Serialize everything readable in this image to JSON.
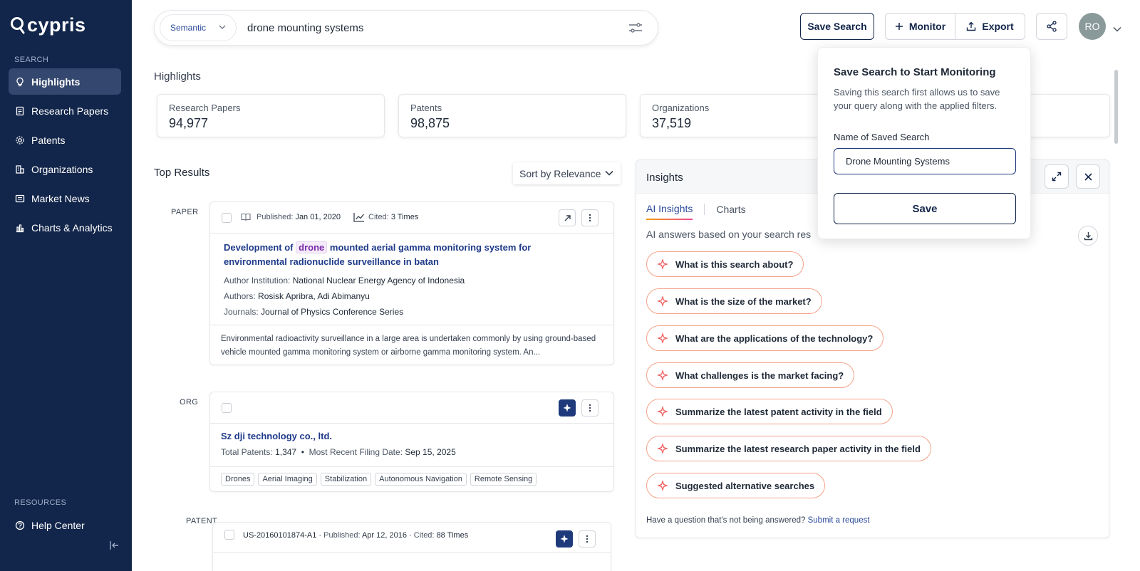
{
  "brand": {
    "name": "cypris"
  },
  "sidebar": {
    "section_search": "SEARCH",
    "items": [
      {
        "label": "Highlights",
        "icon": "lightbulb-icon",
        "active": true
      },
      {
        "label": "Research Papers",
        "icon": "document-icon"
      },
      {
        "label": "Patents",
        "icon": "gear-icon"
      },
      {
        "label": "Organizations",
        "icon": "building-icon"
      },
      {
        "label": "Market News",
        "icon": "newspaper-icon"
      },
      {
        "label": "Charts & Analytics",
        "icon": "bar-chart-icon"
      }
    ],
    "section_resources": "RESOURCES",
    "help_label": "Help Center"
  },
  "search": {
    "mode": "Semantic",
    "query": "drone mounting systems"
  },
  "toolbar": {
    "save_search": "Save Search",
    "monitor": "Monitor",
    "export": "Export",
    "avatar_initials": "RO"
  },
  "highlights": {
    "title": "Highlights",
    "stats": [
      {
        "label": "Research Papers",
        "value": "94,977"
      },
      {
        "label": "Patents",
        "value": "98,875"
      },
      {
        "label": "Organizations",
        "value": "37,519"
      }
    ]
  },
  "results": {
    "title": "Top Results",
    "sort_label": "Sort by Relevance",
    "paper": {
      "type": "PAPER",
      "published_key": "Published:",
      "published": "Jan 01, 2020",
      "cited_key": "Cited:",
      "cited": "3 Times",
      "title_pre": "Development of",
      "title_highlight": "drone",
      "title_post": "mounted aerial gamma monitoring system for environmental radionuclide surveillance in batan",
      "institution_key": "Author Institution:",
      "institution": "National Nuclear Energy Agency of Indonesia",
      "authors_key": "Authors:",
      "authors": "Rosisk Apribra, Adi Abimanyu",
      "journals_key": "Journals:",
      "journals": "Journal of Physics Conference Series",
      "abstract": "Environmental radioactivity surveillance in a large area is undertaken commonly by using ground-based vehicle mounted gamma monitoring system or airborne gamma monitoring system. An..."
    },
    "org": {
      "type": "ORG",
      "name": "Sz dji technology co., ltd.",
      "patents_key": "Total Patents:",
      "patents": "1,347",
      "filing_key": "Most Recent Filing Date:",
      "filing": "Sep 15, 2025",
      "tags": [
        "Drones",
        "Aerial Imaging",
        "Stabilization",
        "Autonomous Navigation",
        "Remote Sensing"
      ]
    },
    "patent": {
      "type": "PATENT",
      "number": "US-20160101874-A1",
      "published_key": "Published:",
      "published": "Apr 12, 2016",
      "cited_key": "Cited:",
      "cited": "88 Times"
    }
  },
  "insights": {
    "title": "Insights",
    "tab_ai": "AI Insights",
    "tab_charts": "Charts",
    "subtitle": "AI answers based on your search res",
    "questions": [
      "What is this search about?",
      "What is the size of the market?",
      "What are the applications of the technology?",
      "What challenges is the market facing?",
      "Summarize the latest patent activity in the field",
      "Summarize the latest research paper activity in the field",
      "Suggested alternative searches"
    ],
    "footer_text": "Have a question that's not being answered?",
    "footer_link": "Submit a request"
  },
  "save_popover": {
    "title": "Save Search to Start Monitoring",
    "description": "Saving this search first allows us to save your query along with the applied filters.",
    "name_label": "Name of Saved Search",
    "name_value": "Drone Mounting Systems",
    "save_label": "Save"
  },
  "colors": {
    "sidebar_bg": "#12254a",
    "accent": "#1e3a7b",
    "question_border": "#f4a38a",
    "highlight_text": "#7a2aa8"
  }
}
